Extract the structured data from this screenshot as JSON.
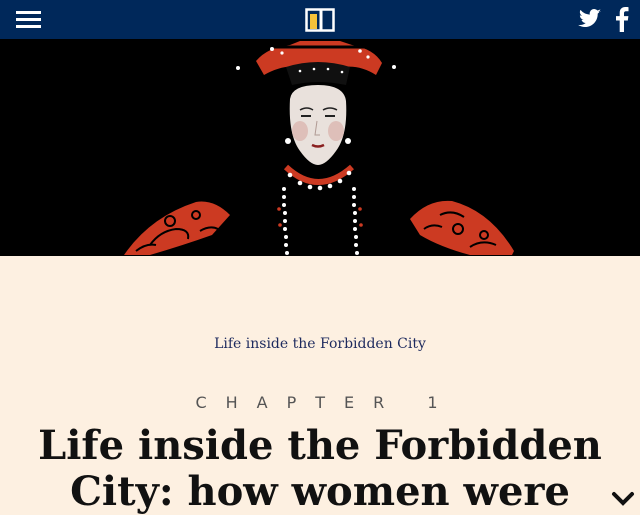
{
  "colors": {
    "topbar_bg": "#00285a",
    "page_bg": "#fdf0e1",
    "hero_bg": "#000000",
    "accent_red": "#cc3a22",
    "logo_yellow": "#f5c23a",
    "link_color": "#1d2a5e"
  },
  "header": {
    "menu_icon": "hamburger-icon",
    "logo_icon": "brand-logo",
    "twitter_icon": "twitter-icon",
    "facebook_icon": "facebook-icon"
  },
  "hero": {
    "illustration": "empress-illustration"
  },
  "article": {
    "section_link": "Life inside the Forbidden City",
    "chapter_label": "CHAPTER 1",
    "headline": "Life inside the Forbidden City: how women were"
  },
  "footer": {
    "scroll_icon": "chevron-down-icon"
  }
}
